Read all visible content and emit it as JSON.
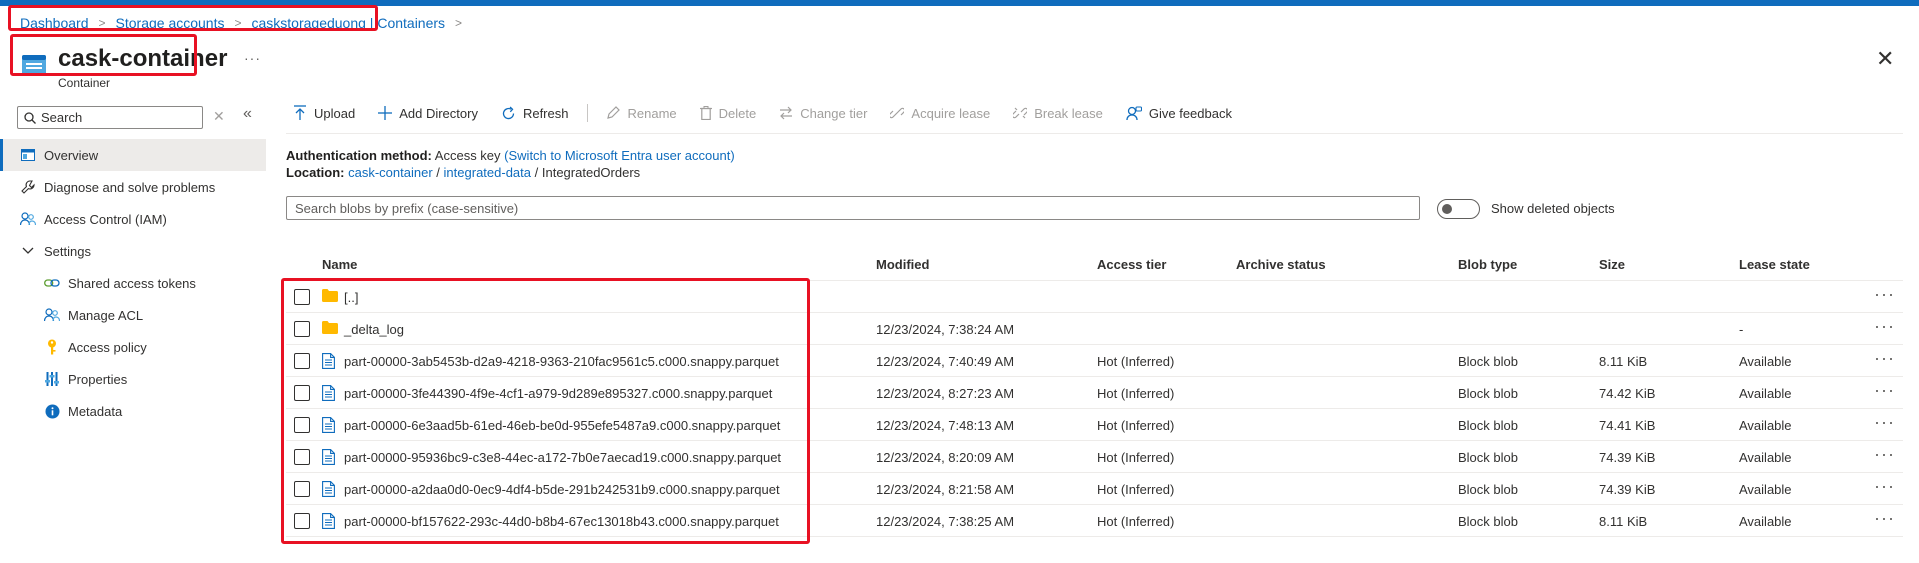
{
  "breadcrumb": [
    "Dashboard",
    "Storage accounts",
    "caskstorageduong | Containers"
  ],
  "page": {
    "title": "cask-container",
    "subtitle": "Container",
    "more_label": "···",
    "close_label": "✕"
  },
  "sidebar": {
    "search_placeholder": "Search",
    "clear_label": "✕",
    "collapse_label": "«",
    "items": [
      {
        "label": "Overview",
        "icon": "overview-icon"
      },
      {
        "label": "Diagnose and solve problems",
        "icon": "wrench-icon"
      },
      {
        "label": "Access Control (IAM)",
        "icon": "people-icon"
      },
      {
        "label": "Settings",
        "icon": "chevron-down-icon"
      },
      {
        "label": "Shared access tokens",
        "icon": "link-icon"
      },
      {
        "label": "Manage ACL",
        "icon": "people-icon"
      },
      {
        "label": "Access policy",
        "icon": "key-icon"
      },
      {
        "label": "Properties",
        "icon": "sliders-icon"
      },
      {
        "label": "Metadata",
        "icon": "info-icon"
      }
    ]
  },
  "toolbar": {
    "upload": "Upload",
    "add_directory": "Add Directory",
    "refresh": "Refresh",
    "rename": "Rename",
    "delete": "Delete",
    "change_tier": "Change tier",
    "acquire_lease": "Acquire lease",
    "break_lease": "Break lease",
    "give_feedback": "Give feedback"
  },
  "info": {
    "auth_label": "Authentication method:",
    "auth_value": "Access key",
    "auth_switch": "(Switch to Microsoft Entra user account)",
    "location_label": "Location:",
    "location_container": "cask-container",
    "location_folder": "integrated-data",
    "location_current": "IntegratedOrders",
    "location_sep": "/"
  },
  "blob_search": {
    "placeholder": "Search blobs by prefix (case-sensitive)"
  },
  "show_deleted": {
    "label": "Show deleted objects"
  },
  "columns": [
    "Name",
    "Modified",
    "Access tier",
    "Archive status",
    "Blob type",
    "Size",
    "Lease state"
  ],
  "rows": [
    {
      "name": "[..]",
      "type": "folder",
      "modified": "",
      "tier": "",
      "archive": "",
      "blob_type": "",
      "size": "",
      "lease": ""
    },
    {
      "name": "_delta_log",
      "type": "folder",
      "modified": "12/23/2024, 7:38:24 AM",
      "tier": "",
      "archive": "",
      "blob_type": "",
      "size": "",
      "lease": "-"
    },
    {
      "name": "part-00000-3ab5453b-d2a9-4218-9363-210fac9561c5.c000.snappy.parquet",
      "type": "file",
      "modified": "12/23/2024, 7:40:49 AM",
      "tier": "Hot (Inferred)",
      "archive": "",
      "blob_type": "Block blob",
      "size": "8.11 KiB",
      "lease": "Available"
    },
    {
      "name": "part-00000-3fe44390-4f9e-4cf1-a979-9d289e895327.c000.snappy.parquet",
      "type": "file",
      "modified": "12/23/2024, 8:27:23 AM",
      "tier": "Hot (Inferred)",
      "archive": "",
      "blob_type": "Block blob",
      "size": "74.42 KiB",
      "lease": "Available"
    },
    {
      "name": "part-00000-6e3aad5b-61ed-46eb-be0d-955efe5487a9.c000.snappy.parquet",
      "type": "file",
      "modified": "12/23/2024, 7:48:13 AM",
      "tier": "Hot (Inferred)",
      "archive": "",
      "blob_type": "Block blob",
      "size": "74.41 KiB",
      "lease": "Available"
    },
    {
      "name": "part-00000-95936bc9-c3e8-44ec-a172-7b0e7aecad19.c000.snappy.parquet",
      "type": "file",
      "modified": "12/23/2024, 8:20:09 AM",
      "tier": "Hot (Inferred)",
      "archive": "",
      "blob_type": "Block blob",
      "size": "74.39 KiB",
      "lease": "Available"
    },
    {
      "name": "part-00000-a2daa0d0-0ec9-4df4-b5de-291b242531b9.c000.snappy.parquet",
      "type": "file",
      "modified": "12/23/2024, 8:21:58 AM",
      "tier": "Hot (Inferred)",
      "archive": "",
      "blob_type": "Block blob",
      "size": "74.39 KiB",
      "lease": "Available"
    },
    {
      "name": "part-00000-bf157622-293c-44d0-b8b4-67ec13018b43.c000.snappy.parquet",
      "type": "file",
      "modified": "12/23/2024, 7:38:25 AM",
      "tier": "Hot (Inferred)",
      "archive": "",
      "blob_type": "Block blob",
      "size": "8.11 KiB",
      "lease": "Available"
    }
  ],
  "row_more_label": "···",
  "colors": {
    "accent": "#0f6cbd",
    "highlight_box": "#e81123",
    "folder": "#ffb900"
  }
}
